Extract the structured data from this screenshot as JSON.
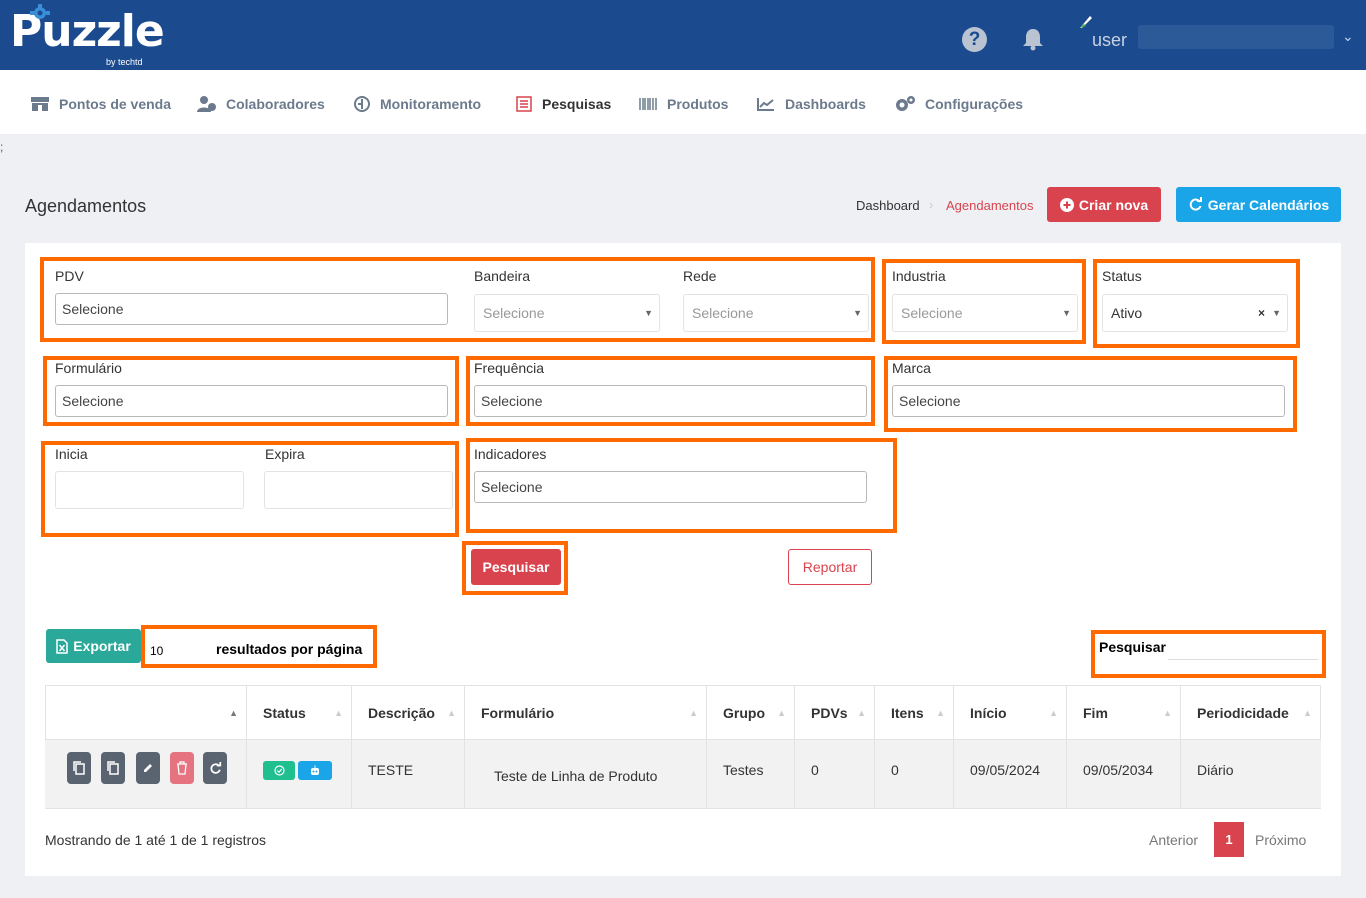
{
  "app": {
    "logo": "Puzzle",
    "logo_sub": "by techtd",
    "user_label": "user"
  },
  "nav": [
    {
      "label": "Pontos de venda",
      "icon": "store-icon"
    },
    {
      "label": "Colaboradores",
      "icon": "users-icon"
    },
    {
      "label": "Monitoramento",
      "icon": "monitor-icon"
    },
    {
      "label": "Pesquisas",
      "icon": "survey-icon",
      "active": true
    },
    {
      "label": "Produtos",
      "icon": "barcode-icon"
    },
    {
      "label": "Dashboards",
      "icon": "chart-icon"
    },
    {
      "label": "Configurações",
      "icon": "gears-icon"
    }
  ],
  "stray_char": ";",
  "page": {
    "title": "Agendamentos",
    "breadcrumb": {
      "home": "Dashboard",
      "current": "Agendamentos"
    },
    "btn_criar": "Criar nova",
    "btn_gerar": "Gerar Calendários"
  },
  "filters": {
    "pdv": {
      "label": "PDV",
      "value": "Selecione"
    },
    "bandeira": {
      "label": "Bandeira",
      "placeholder": "Selecione"
    },
    "rede": {
      "label": "Rede",
      "placeholder": "Selecione"
    },
    "industria": {
      "label": "Industria",
      "placeholder": "Selecione"
    },
    "status": {
      "label": "Status",
      "value": "Ativo",
      "clear": "×"
    },
    "formulario": {
      "label": "Formulário",
      "value": "Selecione"
    },
    "frequencia": {
      "label": "Frequência",
      "value": "Selecione"
    },
    "marca": {
      "label": "Marca",
      "value": "Selecione"
    },
    "inicia": {
      "label": "Inicia"
    },
    "expira": {
      "label": "Expira"
    },
    "indicadores": {
      "label": "Indicadores",
      "value": "Selecione"
    },
    "btn_pesquisar": "Pesquisar",
    "btn_reportar": "Reportar"
  },
  "table_controls": {
    "exportar": "Exportar",
    "page_size": "10",
    "page_size_label": "resultados por página",
    "search_label": "Pesquisar"
  },
  "table": {
    "columns": [
      "",
      "Status",
      "Descrição",
      "Formulário",
      "Grupo",
      "PDVs",
      "Itens",
      "Início",
      "Fim",
      "Periodicidade"
    ],
    "rows": [
      {
        "descricao": "TESTE",
        "formulario": "Teste de Linha de Produto",
        "grupo": "Testes",
        "pdvs": "0",
        "itens": "0",
        "inicio": "09/05/2024",
        "fim": "09/05/2034",
        "periodicidade": "Diário"
      }
    ]
  },
  "pagination": {
    "info": "Mostrando de 1 até 1 de 1 registros",
    "prev": "Anterior",
    "current": "1",
    "next": "Próximo"
  },
  "colors": {
    "primary": "#1b4b8e",
    "danger": "#d9434e",
    "info": "#1aa5e8",
    "teal": "#2aa89a",
    "highlight": "#ff6a00"
  }
}
